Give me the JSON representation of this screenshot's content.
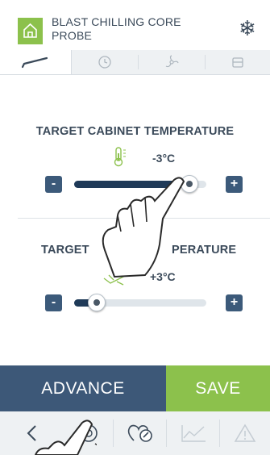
{
  "header": {
    "title": "BLAST CHILLING CORE PROBE",
    "home_icon": "home-icon",
    "mode_icon": "snowflake-icon"
  },
  "tabs": [
    {
      "icon": "probe-icon",
      "active": true
    },
    {
      "icon": "clock-icon",
      "active": false
    },
    {
      "icon": "fan-icon",
      "active": false
    },
    {
      "icon": "tray-icon",
      "active": false
    }
  ],
  "cabinet": {
    "label": "TARGET CABINET TEMPERATURE",
    "value": "-3°C",
    "icon": "thermometer-icon",
    "minus": "-",
    "plus": "+",
    "level": 0.87
  },
  "probe": {
    "label_left": "TARGET",
    "label_right": "PERATURE",
    "value": "+3°C",
    "icon": "probe-temperature-icon",
    "minus": "-",
    "plus": "+",
    "level": 0.17
  },
  "actions": {
    "advance": "ADVANCE",
    "save": "SAVE"
  },
  "nav": [
    {
      "icon": "back-icon"
    },
    {
      "icon": "recipe-icon"
    },
    {
      "icon": "favorites-icon"
    },
    {
      "icon": "graph-icon"
    },
    {
      "icon": "warning-icon"
    }
  ],
  "colors": {
    "accent_green": "#8cc14c",
    "navy": "#3d5878",
    "slider_fill": "#1f3a58"
  }
}
